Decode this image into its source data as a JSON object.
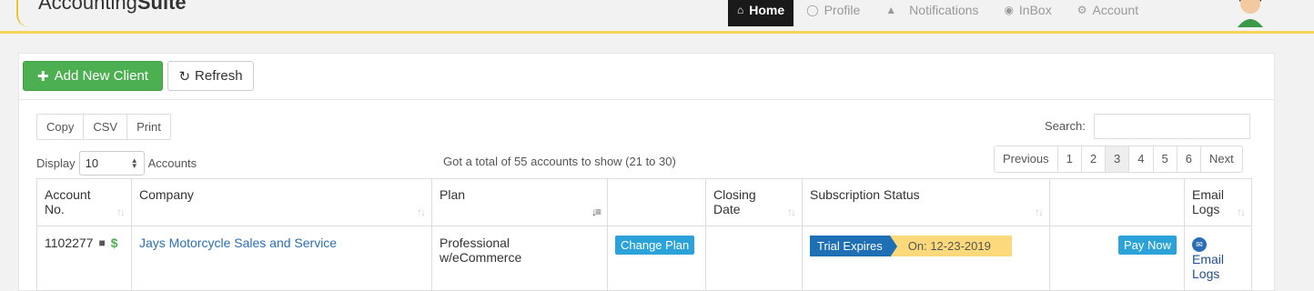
{
  "header": {
    "logo_plain": "Accounting",
    "logo_bold": "Suite",
    "nav": [
      {
        "label": "Home",
        "icon": "home-icon"
      },
      {
        "label": "Profile",
        "icon": "user-icon"
      },
      {
        "label": "",
        "icon": "bell-icon"
      },
      {
        "label": "Notifications",
        "icon": "none"
      },
      {
        "label": "InBox",
        "icon": "inbox-icon"
      },
      {
        "label": "Account",
        "icon": "gear-icon"
      }
    ]
  },
  "toolbar": {
    "add_label": "Add New Client",
    "refresh_label": "Refresh"
  },
  "export": {
    "copy": "Copy",
    "csv": "CSV",
    "print": "Print"
  },
  "search": {
    "label": "Search:",
    "value": ""
  },
  "display": {
    "label": "Display",
    "value": "10",
    "suffix": "Accounts"
  },
  "summary": "Got a total of 55 accounts to show (21 to 30)",
  "pager": {
    "previous": "Previous",
    "pages": [
      "1",
      "2",
      "3",
      "4",
      "5",
      "6"
    ],
    "current": "3",
    "next": "Next"
  },
  "table": {
    "headers": {
      "account_line1": "Account",
      "account_line2": "No.",
      "company": "Company",
      "plan": "Plan",
      "closing_line1": "Closing",
      "closing_line2": "Date",
      "status": "Subscription Status",
      "email_line1": "Email",
      "email_line2": "Logs"
    },
    "rows": [
      {
        "account_no": "1102277",
        "company": "Jays Motorcycle Sales and Service",
        "plan_line1": "Professional",
        "plan_line2": "w/eCommerce",
        "change_plan": "Change Plan",
        "closing_date": "",
        "status_label": "Trial Expires",
        "status_date": "On: 12-23-2019",
        "pay_now": "Pay Now",
        "email_line1": "Email",
        "email_line2": "Logs"
      }
    ]
  },
  "colors": {
    "accent_yellow": "#f7d358",
    "add_green": "#4caf50",
    "trial_blue": "#1f6fb5",
    "on_yellow": "#fcd97a",
    "button_blue": "#2ba3d8"
  }
}
